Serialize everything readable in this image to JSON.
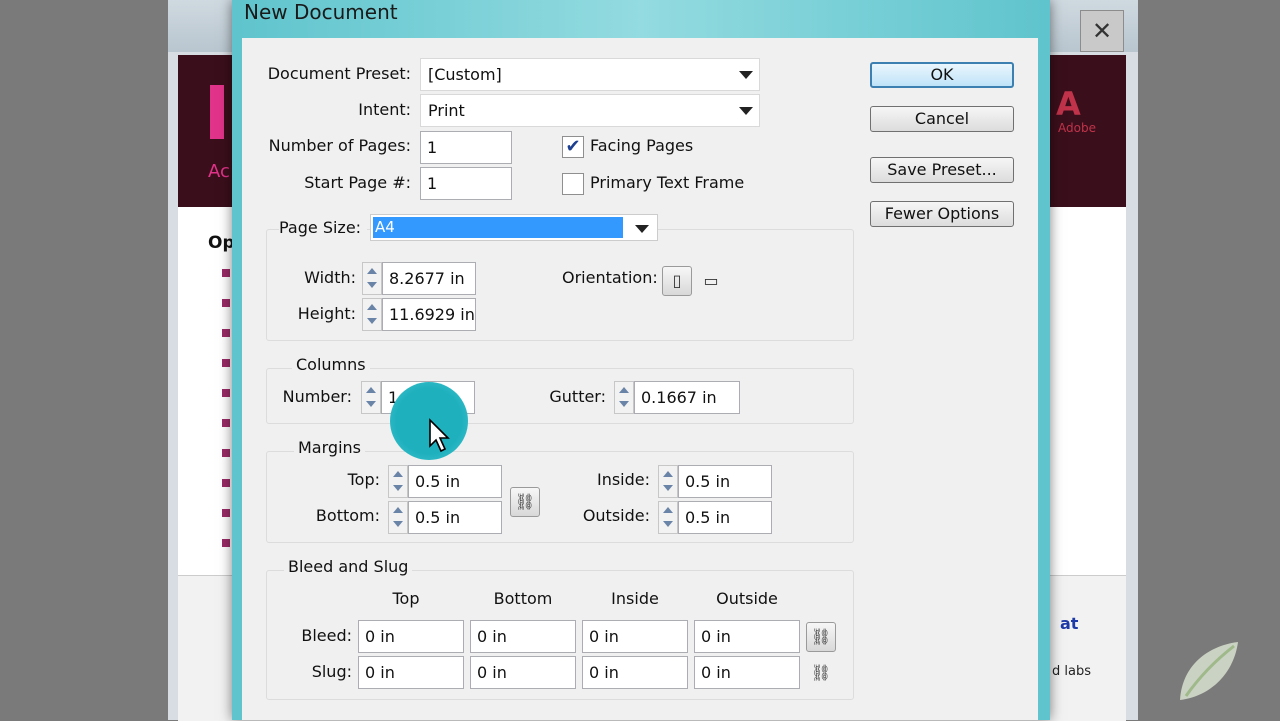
{
  "background": {
    "partial_heading": "Op",
    "banner_partial_text": "Ac",
    "adobe_text": "Adobe",
    "right_partial_text": "at",
    "right_partial_text2": "d labs"
  },
  "dialog": {
    "title": "New Document",
    "document_preset": {
      "label": "Document Preset:",
      "value": "[Custom]"
    },
    "intent": {
      "label": "Intent:",
      "value": "Print"
    },
    "number_of_pages": {
      "label": "Number of Pages:",
      "value": "1"
    },
    "start_page": {
      "label": "Start Page #:",
      "value": "1"
    },
    "facing_pages": {
      "label": "Facing Pages",
      "checked": true
    },
    "primary_text_frame": {
      "label": "Primary Text Frame",
      "checked": false
    },
    "page_size": {
      "label": "Page Size:",
      "value": "A4"
    },
    "width": {
      "label": "Width:",
      "value": "8.2677 in"
    },
    "height": {
      "label": "Height:",
      "value": "11.6929 in"
    },
    "orientation": {
      "label": "Orientation:"
    },
    "columns": {
      "heading": "Columns",
      "number_label": "Number:",
      "number_value": "1",
      "gutter_label": "Gutter:",
      "gutter_value": "0.1667 in"
    },
    "margins": {
      "heading": "Margins",
      "top_label": "Top:",
      "top_value": "0.5 in",
      "bottom_label": "Bottom:",
      "bottom_value": "0.5 in",
      "inside_label": "Inside:",
      "inside_value": "0.5 in",
      "outside_label": "Outside:",
      "outside_value": "0.5 in"
    },
    "bleed_slug": {
      "heading": "Bleed and Slug",
      "col_headers": [
        "Top",
        "Bottom",
        "Inside",
        "Outside"
      ],
      "bleed_label": "Bleed:",
      "bleed_values": [
        "0 in",
        "0 in",
        "0 in",
        "0 in"
      ],
      "slug_label": "Slug:",
      "slug_values": [
        "0 in",
        "0 in",
        "0 in",
        "0 in"
      ]
    },
    "buttons": {
      "ok": "OK",
      "cancel": "Cancel",
      "save_preset": "Save Preset...",
      "fewer_options": "Fewer Options"
    }
  },
  "colors": {
    "title_bar": "#8fd3da",
    "selection": "#3399ff",
    "default_button_border": "#3c7fb1",
    "ripple": "#1fb0be"
  }
}
